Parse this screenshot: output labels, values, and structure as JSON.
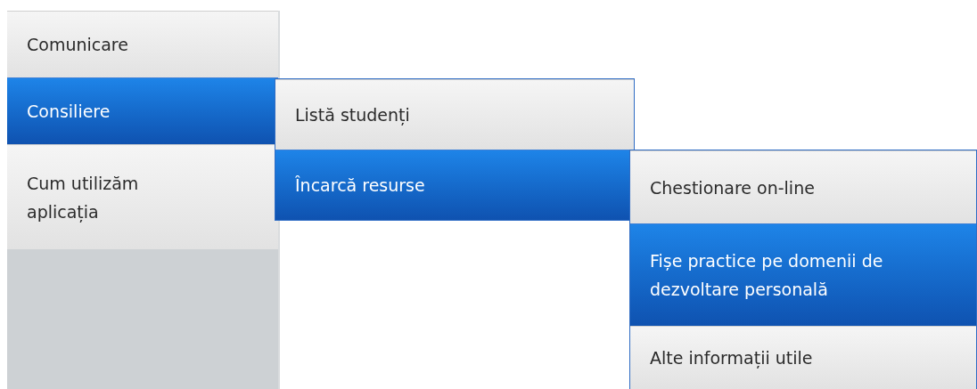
{
  "menu": [
    {
      "label": "Comunicare",
      "selected": false
    },
    {
      "label": "Consiliere",
      "selected": true,
      "children": [
        {
          "label": "Listă studenți",
          "selected": false
        },
        {
          "label": "Încarcă resurse",
          "selected": true,
          "children": [
            {
              "label": "Chestionare on-line",
              "selected": false
            },
            {
              "label": "Fișe practice pe domenii de dezvoltare personală",
              "selected": true
            },
            {
              "label": "Alte informații utile",
              "selected": false
            }
          ]
        }
      ]
    },
    {
      "label": "Cum utilizăm aplicația",
      "selected": false
    }
  ]
}
